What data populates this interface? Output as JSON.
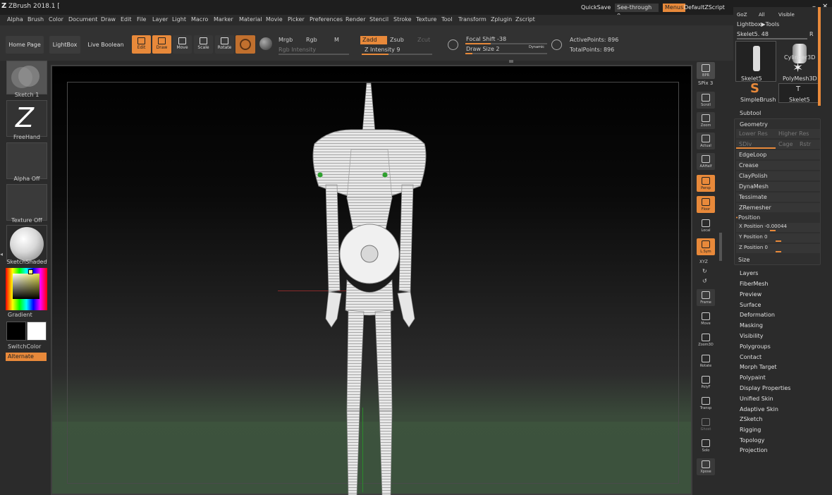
{
  "titlebar": {
    "title": "ZBrush 2018.1 [",
    "quicksave": "QuickSave",
    "seethrough": "See-through  0",
    "menus": "Menus",
    "defaultscript": "DefaultZScript"
  },
  "menu": [
    "Alpha",
    "Brush",
    "Color",
    "Document",
    "Draw",
    "Edit",
    "File",
    "Layer",
    "Light",
    "Macro",
    "Marker",
    "Material",
    "Movie",
    "Picker",
    "Preferences",
    "Render",
    "Stencil",
    "Stroke",
    "Texture",
    "Tool",
    "Transform",
    "Zplugin",
    "Zscript"
  ],
  "shelf": {
    "home_page": "Home Page",
    "lightbox": "LightBox",
    "live_boolean": "Live Boolean",
    "edit": "Edit",
    "draw": "Draw",
    "move": "Move",
    "scale": "Scale",
    "rotate": "Rotate",
    "mrgb": "Mrgb",
    "rgb": "Rgb",
    "m": "M",
    "rgb_intensity": "Rgb Intensity",
    "zadd": "Zadd",
    "zsub": "Zsub",
    "zcut": "Zcut",
    "z_intensity": "Z Intensity 9",
    "focal_shift": "Focal Shift -38",
    "draw_size": "Draw Size 2",
    "dynamic": "Dynamic",
    "active_points": "ActivePoints: 896",
    "total_points": "TotalPoints: 896"
  },
  "left": {
    "sketch": "Sketch 1",
    "freehand": "FreeHand",
    "alpha": "Alpha Off",
    "texture": "Texture Off",
    "material": "SketchShaded",
    "gradient": "Gradient",
    "switchcolor": "SwitchColor",
    "alternate": "Alternate"
  },
  "rtools": [
    "BPR",
    "SPix 3",
    "Scroll",
    "Zoom",
    "Actual",
    "AAHalf",
    "Persp",
    "Floor",
    "Local",
    "L.Sym",
    "XYZ",
    "",
    "",
    "Frame",
    "Move",
    "Zoom3D",
    "Rotate",
    "PolyF",
    "Transp",
    "Ghost",
    "Solo",
    "Xpose"
  ],
  "rpanel": {
    "top_row": [
      "GoZ",
      "All",
      "Visible"
    ],
    "lightbox_tools": "Lightbox▶Tools",
    "skelet_slider": "Skelet5. 48",
    "r_label": "R",
    "tools": [
      "Skelet5",
      "Cylinder3D",
      "PolyMesh3D",
      "SimpleBrush",
      "Skelet5"
    ],
    "subtool": "Subtool",
    "geometry": "Geometry",
    "lower_res": "Lower Res",
    "higher_res": "Higher Res",
    "sdiv": "SDiv",
    "cage": "Cage",
    "rstr": "Rstr",
    "geo_buttons": [
      "EdgeLoop",
      "Crease",
      "ClayPolish",
      "DynaMesh",
      "Tessimate",
      "ZRemesher"
    ],
    "position": "Position",
    "x_pos": "X Position -0.00044",
    "y_pos": "Y Position 0",
    "z_pos": "Z Position 0",
    "size": "Size",
    "sections": [
      "Layers",
      "FiberMesh",
      "Preview",
      "Surface",
      "Deformation",
      "Masking",
      "Visibility",
      "Polygroups",
      "Contact",
      "Morph Target",
      "Polypaint",
      "Display Properties",
      "Unified Skin",
      "Adaptive Skin",
      "ZSketch",
      "Rigging",
      "Topology",
      "Projection"
    ]
  },
  "colors": {
    "accent": "#e8893a",
    "bg": "#2b2b2b"
  }
}
